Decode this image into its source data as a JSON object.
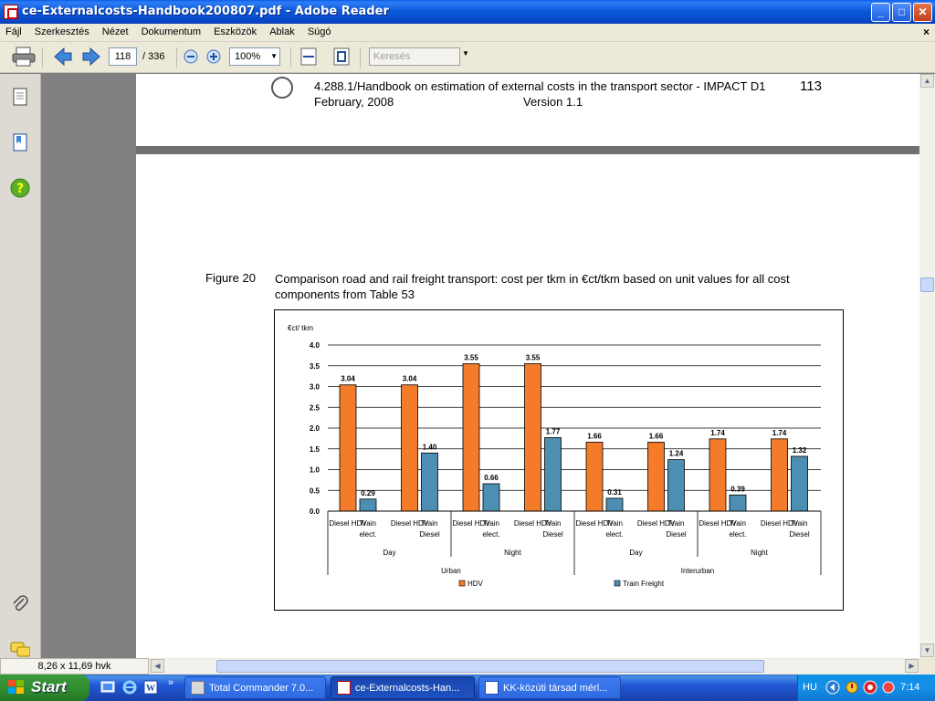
{
  "window": {
    "title": "ce-Externalcosts-Handbook200807.pdf - Adobe Reader",
    "min": "_",
    "max": "□",
    "close": "✕"
  },
  "menu": {
    "items": [
      "Fájl",
      "Szerkesztés",
      "Nézet",
      "Dokumentum",
      "Eszközök",
      "Ablak",
      "Súgó"
    ],
    "close": "×"
  },
  "toolbar": {
    "page_current": "118",
    "page_total": "/ 336",
    "zoom": "100%",
    "search_placeholder": "Keresés"
  },
  "document": {
    "header_line1": "4.288.1/Handbook on estimation of external costs in the transport sector - IMPACT D1",
    "header_date": "February, 2008",
    "header_version": "Version 1.1",
    "page_number": "113",
    "figure_label": "Figure 20",
    "figure_caption": "Comparison road and rail freight transport: cost per tkm in €ct/tkm based on unit values for all cost components from Table 53"
  },
  "chart_data": {
    "type": "bar",
    "ylabel": "€ct/ tkm",
    "ylim": [
      0,
      4
    ],
    "yticks": [
      "0.0",
      "0.5",
      "1.0",
      "1.5",
      "2.0",
      "2.5",
      "3.0",
      "3.5",
      "4.0"
    ],
    "grid": true,
    "legend_position": "bottom",
    "colors": {
      "HDV": "#f47b29",
      "Train Freight": "#4d8fb2"
    },
    "categories": [
      {
        "hdv_label": "Diesel HDV",
        "train_label": "Train elect.",
        "period": "Day",
        "area": "Urban"
      },
      {
        "hdv_label": "Diesel HDV",
        "train_label": "Train Diesel",
        "period": "Day",
        "area": "Urban"
      },
      {
        "hdv_label": "Diesel HDV",
        "train_label": "Train elect.",
        "period": "Night",
        "area": "Urban"
      },
      {
        "hdv_label": "Diesel HDV",
        "train_label": "Train Diesel",
        "period": "Night",
        "area": "Urban"
      },
      {
        "hdv_label": "Diesel HDV",
        "train_label": "Train elect.",
        "period": "Day",
        "area": "Interurban"
      },
      {
        "hdv_label": "Diesel HDV",
        "train_label": "Train Diesel",
        "period": "Day",
        "area": "Interurban"
      },
      {
        "hdv_label": "Diesel HDV",
        "train_label": "Train elect.",
        "period": "Night",
        "area": "Interurban"
      },
      {
        "hdv_label": "Diesel HDV",
        "train_label": "Train Diesel",
        "period": "Night",
        "area": "Interurban"
      }
    ],
    "period_labels": [
      "Day",
      "Night",
      "Day",
      "Night"
    ],
    "area_labels": [
      "Urban",
      "Interurban"
    ],
    "series": [
      {
        "name": "HDV",
        "values": [
          3.04,
          3.04,
          3.55,
          3.55,
          1.66,
          1.66,
          1.74,
          1.74
        ]
      },
      {
        "name": "Train Freight",
        "values": [
          0.29,
          1.4,
          0.66,
          1.77,
          0.31,
          1.24,
          0.39,
          1.32
        ]
      }
    ],
    "data_labels": {
      "HDV": [
        "3.04",
        "3.04",
        "3.55",
        "3.55",
        "1.66",
        "1.66",
        "1.74",
        "1.74"
      ],
      "Train Freight": [
        "0.29",
        "1.40",
        "0.66",
        "1.77",
        "0.31",
        "1.24",
        "0.39",
        "1.32"
      ]
    }
  },
  "statusbar": {
    "page_size": "8,26 x 11,69 hvk"
  },
  "taskbar": {
    "start": "Start",
    "more": "»",
    "tasks": [
      {
        "label": "Total Commander 7.0...",
        "active": false
      },
      {
        "label": "ce-Externalcosts-Han...",
        "active": true
      },
      {
        "label": "KK-közúti társad mérl...",
        "active": false
      }
    ],
    "lang": "HU",
    "clock": "7:14"
  }
}
